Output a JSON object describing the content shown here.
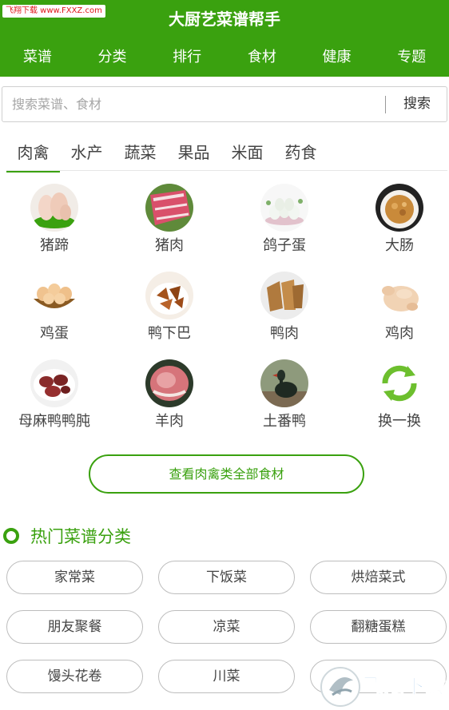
{
  "watermark": "飞翔下载 www.FXXZ.com",
  "header": {
    "title": "大厨艺菜谱帮手",
    "nav": [
      "菜谱",
      "分类",
      "排行",
      "食材",
      "健康",
      "专题"
    ]
  },
  "search": {
    "placeholder": "搜索菜谱、食材",
    "value": "",
    "button": "搜索"
  },
  "category_tabs": {
    "items": [
      "肉禽",
      "水产",
      "蔬菜",
      "果品",
      "米面",
      "药食"
    ],
    "active": "肉禽"
  },
  "foods": [
    {
      "label": "猪蹄",
      "icon": "pig-trotter-photo"
    },
    {
      "label": "猪肉",
      "icon": "pork-photo"
    },
    {
      "label": "鸽子蛋",
      "icon": "pigeon-egg-photo"
    },
    {
      "label": "大肠",
      "icon": "intestine-photo"
    },
    {
      "label": "鸡蛋",
      "icon": "egg-basket-photo"
    },
    {
      "label": "鸭下巴",
      "icon": "duck-chin-photo"
    },
    {
      "label": "鸭肉",
      "icon": "duck-meat-photo"
    },
    {
      "label": "鸡肉",
      "icon": "chicken-photo"
    },
    {
      "label": "母麻鸭鸭肫",
      "icon": "duck-gizzard-photo"
    },
    {
      "label": "羊肉",
      "icon": "mutton-photo"
    },
    {
      "label": "土番鸭",
      "icon": "muscovy-duck-photo"
    },
    {
      "label": "换一换",
      "icon": "refresh-icon"
    }
  ],
  "view_all_button": "查看肉禽类全部食材",
  "hot_section": {
    "title": "热门菜谱分类",
    "items": [
      "家常菜",
      "下饭菜",
      "烘焙菜式",
      "朋友聚餐",
      "凉菜",
      "翻糖蛋糕",
      "馒头花卷",
      "川菜",
      ""
    ]
  },
  "brand_logo_text": "飞翔下载",
  "colors": {
    "primary": "#3aa10f",
    "header_text": "#ffffff",
    "pill_border": "#bdbdbd"
  }
}
